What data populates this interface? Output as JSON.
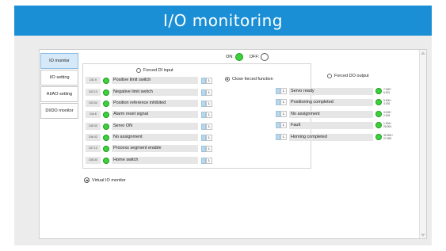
{
  "window": {
    "title": "I/O monitoring"
  },
  "tabs": [
    {
      "label": "IO monitor",
      "active": true
    },
    {
      "label": "I/O setting",
      "active": false
    },
    {
      "label": "AI/AO setting",
      "active": false
    },
    {
      "label": "DI/DO monitor",
      "active": false
    }
  ],
  "legend": {
    "on_label": "ON:",
    "off_label": "OFF:",
    "on_color": "#3cd23c"
  },
  "forced_di": {
    "label": "Forced DI input",
    "checked": false
  },
  "close_forced": {
    "label": "Close forced function",
    "checked": true
  },
  "forced_do": {
    "label": "Forced DO output",
    "checked": false
  },
  "di_rows": [
    {
      "code": "DI1 9",
      "name": "Positive limit switch",
      "lock": "L"
    },
    {
      "code": "DI2 10",
      "name": "Negative limit switch",
      "lock": "L"
    },
    {
      "code": "DI3 34",
      "name": "Position reference inhibited",
      "lock": "L"
    },
    {
      "code": "DI4 8",
      "name": "Alarm reset signal",
      "lock": "L"
    },
    {
      "code": "DI5 33",
      "name": "Servo ON",
      "lock": "L"
    },
    {
      "code": "DI6 32",
      "name": "No assignment",
      "lock": "L"
    },
    {
      "code": "DI7 12",
      "name": "Process segment enable",
      "lock": "L"
    },
    {
      "code": "DI8 30",
      "name": "Home switch",
      "lock": "L"
    }
  ],
  "do_rows": [
    {
      "name": "Servo ready",
      "lock": "L",
      "v1": "7.000+",
      "v2": "6.001"
    },
    {
      "name": "Positioning completed",
      "lock": "L",
      "v1": "5.000+",
      "v2": "4.002"
    },
    {
      "name": "No assignment",
      "lock": "L",
      "v1": "3.003+",
      "v2": "2.003"
    },
    {
      "name": "Fault",
      "lock": "L",
      "v1": "1.004+",
      "v2": "26.004"
    },
    {
      "name": "Homing completed",
      "lock": "L",
      "v1": "30.005+",
      "v2": "27.005"
    }
  ],
  "virtual_io": {
    "label": "Virtual IO monitor"
  }
}
